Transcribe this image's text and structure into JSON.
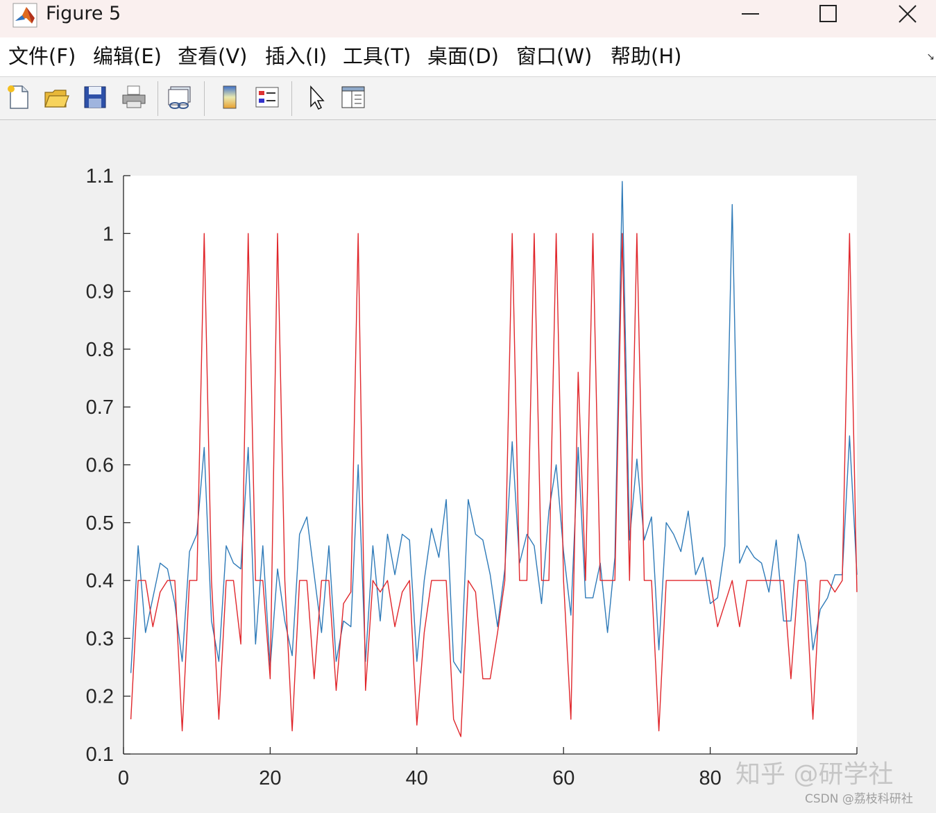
{
  "window": {
    "title": "Figure 5",
    "minimize_icon": "minimize-icon",
    "maximize_icon": "maximize-icon",
    "close_icon": "close-icon"
  },
  "menu": [
    {
      "label": "文件(F)"
    },
    {
      "label": "编辑(E)"
    },
    {
      "label": "查看(V)"
    },
    {
      "label": "插入(I)"
    },
    {
      "label": "工具(T)"
    },
    {
      "label": "桌面(D)"
    },
    {
      "label": "窗口(W)"
    },
    {
      "label": "帮助(H)"
    }
  ],
  "toolbar": {
    "icons": [
      "new-figure-icon",
      "open-file-icon",
      "save-icon",
      "print-icon",
      "link-plot-icon",
      "insert-colorbar-icon",
      "insert-legend-icon",
      "edit-plot-icon",
      "property-inspector-icon"
    ]
  },
  "colors": {
    "blue_series": "#2e7ab8",
    "red_series": "#e0262b",
    "plot_bg": "#ffffff",
    "figure_bg": "#f0f0f0"
  },
  "watermark": {
    "zhihu": "知乎 @研学社",
    "csdn": "CSDN @荔枝科研社"
  },
  "chart_data": {
    "type": "line",
    "xlim": [
      0,
      100
    ],
    "ylim": [
      0.1,
      1.1
    ],
    "xticks": [
      "0",
      "20",
      "40",
      "60",
      "80"
    ],
    "yticks": [
      "0.1",
      "0.2",
      "0.3",
      "0.4",
      "0.5",
      "0.6",
      "0.7",
      "0.8",
      "0.9",
      "1",
      "1.1"
    ],
    "grid": false,
    "x": [
      1,
      2,
      3,
      4,
      5,
      6,
      7,
      8,
      9,
      10,
      11,
      12,
      13,
      14,
      15,
      16,
      17,
      18,
      19,
      20,
      21,
      22,
      23,
      24,
      25,
      26,
      27,
      28,
      29,
      30,
      31,
      32,
      33,
      34,
      35,
      36,
      37,
      38,
      39,
      40,
      41,
      42,
      43,
      44,
      45,
      46,
      47,
      48,
      49,
      50,
      51,
      52,
      53,
      54,
      55,
      56,
      57,
      58,
      59,
      60,
      61,
      62,
      63,
      64,
      65,
      66,
      67,
      68,
      69,
      70,
      71,
      72,
      73,
      74,
      75,
      76,
      77,
      78,
      79,
      80,
      81,
      82,
      83,
      84,
      85,
      86,
      87,
      88,
      89,
      90,
      91,
      92,
      93,
      94,
      95,
      96,
      97,
      98,
      99,
      100
    ],
    "series": [
      {
        "color": "#2e7ab8",
        "values": [
          0.24,
          0.46,
          0.31,
          0.37,
          0.43,
          0.42,
          0.36,
          0.26,
          0.45,
          0.48,
          0.63,
          0.33,
          0.26,
          0.46,
          0.43,
          0.42,
          0.63,
          0.29,
          0.46,
          0.25,
          0.42,
          0.33,
          0.27,
          0.48,
          0.51,
          0.41,
          0.31,
          0.46,
          0.26,
          0.33,
          0.32,
          0.6,
          0.26,
          0.46,
          0.33,
          0.48,
          0.41,
          0.48,
          0.47,
          0.26,
          0.4,
          0.49,
          0.44,
          0.54,
          0.26,
          0.24,
          0.54,
          0.48,
          0.47,
          0.41,
          0.32,
          0.42,
          0.64,
          0.43,
          0.48,
          0.46,
          0.36,
          0.52,
          0.6,
          0.45,
          0.34,
          0.63,
          0.37,
          0.37,
          0.43,
          0.31,
          0.44,
          1.09,
          0.47,
          0.61,
          0.47,
          0.51,
          0.28,
          0.5,
          0.48,
          0.45,
          0.52,
          0.41,
          0.44,
          0.36,
          0.37,
          0.46,
          1.05,
          0.43,
          0.46,
          0.44,
          0.43,
          0.38,
          0.47,
          0.33,
          0.33,
          0.48,
          0.43,
          0.28,
          0.35,
          0.37,
          0.41,
          0.41,
          0.65,
          0.41
        ]
      },
      {
        "color": "#e0262b",
        "values": [
          0.16,
          0.4,
          0.4,
          0.32,
          0.38,
          0.4,
          0.4,
          0.14,
          0.4,
          0.4,
          1.0,
          0.4,
          0.16,
          0.4,
          0.4,
          0.29,
          1.0,
          0.4,
          0.4,
          0.23,
          1.0,
          0.4,
          0.14,
          0.4,
          0.4,
          0.23,
          0.4,
          0.4,
          0.21,
          0.36,
          0.38,
          1.0,
          0.21,
          0.4,
          0.38,
          0.4,
          0.32,
          0.38,
          0.4,
          0.15,
          0.31,
          0.4,
          0.4,
          0.4,
          0.16,
          0.13,
          0.4,
          0.38,
          0.23,
          0.23,
          0.31,
          0.4,
          1.0,
          0.4,
          0.4,
          1.0,
          0.4,
          0.4,
          1.0,
          0.4,
          0.16,
          0.76,
          0.4,
          1.0,
          0.4,
          0.4,
          0.4,
          1.0,
          0.4,
          1.0,
          0.4,
          0.4,
          0.14,
          0.4,
          0.4,
          0.4,
          0.4,
          0.4,
          0.4,
          0.4,
          0.32,
          0.36,
          0.4,
          0.32,
          0.4,
          0.4,
          0.4,
          0.4,
          0.4,
          0.4,
          0.23,
          0.4,
          0.4,
          0.16,
          0.4,
          0.4,
          0.38,
          0.4,
          1.0,
          0.38
        ]
      }
    ]
  }
}
